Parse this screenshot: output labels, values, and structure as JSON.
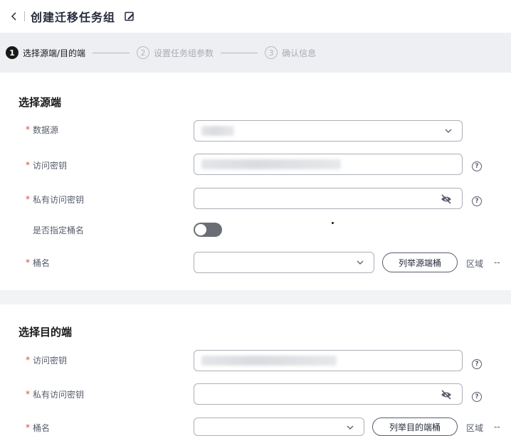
{
  "header": {
    "title": "创建迁移任务组"
  },
  "steps": [
    {
      "num": "1",
      "label": "选择源端/目的端"
    },
    {
      "num": "2",
      "label": "设置任务组参数"
    },
    {
      "num": "3",
      "label": "确认信息"
    }
  ],
  "source": {
    "title": "选择源端",
    "data_source_label": "数据源",
    "access_key_label": "访问密钥",
    "secret_key_label": "私有访问密钥",
    "specify_bucket_label": "是否指定桶名",
    "bucket_label": "桶名",
    "list_button": "列举源端桶",
    "region_label": "区域",
    "region_value": "--"
  },
  "destination": {
    "title": "选择目的端",
    "access_key_label": "访问密钥",
    "secret_key_label": "私有访问密钥",
    "bucket_label": "桶名",
    "list_button": "列举目的端桶",
    "region_label": "区域",
    "region_value": "--"
  },
  "required_mark": "*",
  "help_glyph": "?",
  "icons": [
    "back-icon",
    "edit-icon",
    "chevron-down-icon",
    "eye-off-icon",
    "help-icon"
  ]
}
